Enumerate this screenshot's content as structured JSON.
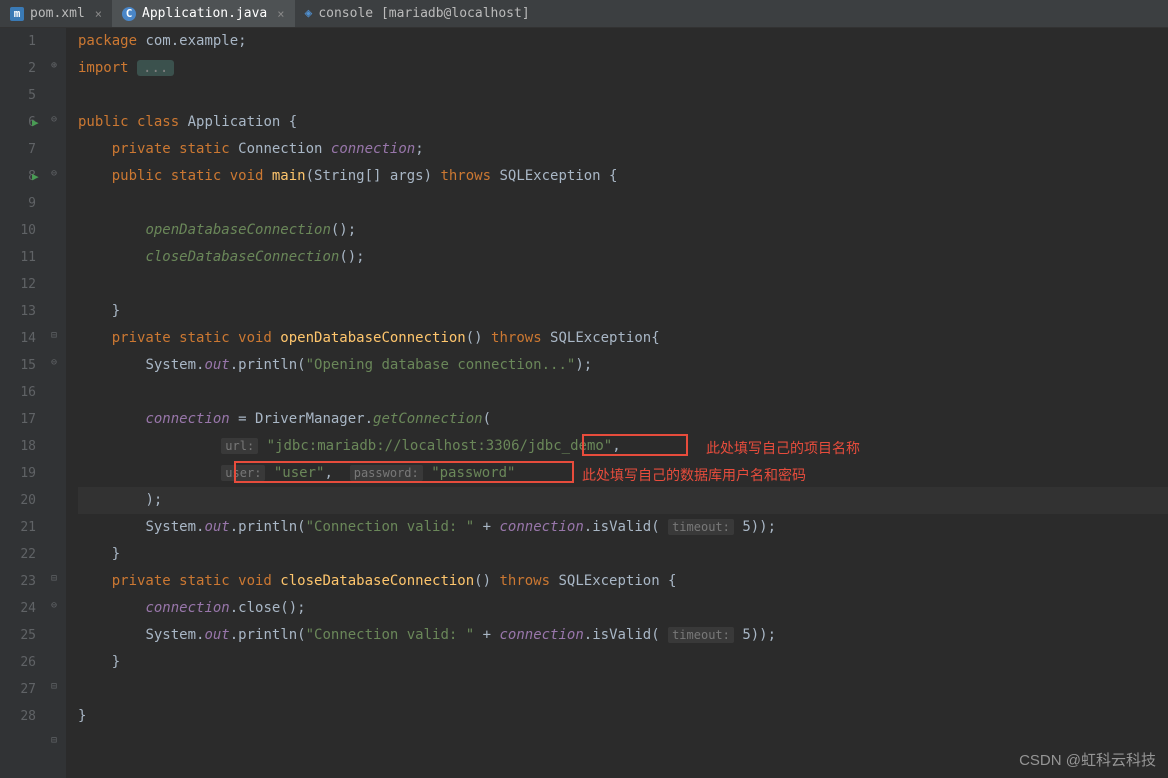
{
  "tabs": [
    {
      "label": "pom.xml",
      "icon": "m",
      "active": false
    },
    {
      "label": "Application.java",
      "icon": "c",
      "active": true
    },
    {
      "label": "console [mariadb@localhost]",
      "icon": "db",
      "active": false
    }
  ],
  "gutter": {
    "lines": [
      "1",
      "2",
      "5",
      "6",
      "7",
      "8",
      "9",
      "10",
      "11",
      "12",
      "13",
      "14",
      "15",
      "16",
      "17",
      "18",
      "19",
      "20",
      "21",
      "22",
      "23",
      "24",
      "25",
      "26",
      "27",
      "28"
    ],
    "runMarkers": [
      6,
      8
    ]
  },
  "code": {
    "l1": {
      "kw1": "package",
      "pkg": " com.example;"
    },
    "l2": {
      "kw1": "import",
      "folded": "..."
    },
    "l6": {
      "kw1": "public class",
      "cls": " Application {"
    },
    "l7": {
      "kw1": "private static",
      "type": " Connection ",
      "field": "connection",
      "t": ";"
    },
    "l8": {
      "kw1": "public static void",
      "method": " main",
      "sig": "(String[] args) ",
      "kw2": "throws",
      "ex": " SQLException {"
    },
    "l10": {
      "call": "openDatabaseConnection",
      "t": "();"
    },
    "l11": {
      "call": "closeDatabaseConnection",
      "t": "();"
    },
    "l13": {
      "t": "}"
    },
    "l14": {
      "kw1": "private static void",
      "method": " openDatabaseConnection",
      "sig": "() ",
      "kw2": "throws",
      "ex": " SQLException{"
    },
    "l15": {
      "obj": "System.",
      "f": "out",
      "m": ".println(",
      "s": "\"Opening database connection...\"",
      "t": ");"
    },
    "l17": {
      "f": "connection",
      "t1": " = DriverManager.",
      "m": "getConnection",
      "t2": "("
    },
    "l18": {
      "hint": "url:",
      "s1": "\"jdbc:mariadb://localhost:3306/",
      "s2": "jdbc_demo\"",
      "t": ","
    },
    "l19": {
      "hint1": "user:",
      "s1": "\"user\"",
      "t1": ",  ",
      "hint2": "password:",
      "s2": "\"password\""
    },
    "l20": {
      "t": ");"
    },
    "l21": {
      "obj": "System.",
      "f": "out",
      "m": ".println(",
      "s": "\"Connection valid: \"",
      "t1": " + ",
      "f2": "connection",
      "t2": ".isValid( ",
      "hint": "timeout:",
      "num": "5",
      "t3": "));"
    },
    "l22": {
      "t": "}"
    },
    "l23": {
      "kw1": "private static void",
      "method": " closeDatabaseConnection",
      "sig": "() ",
      "kw2": "throws",
      "ex": " SQLException {"
    },
    "l24": {
      "f": "connection",
      "t": ".close();"
    },
    "l25": {
      "obj": "System.",
      "f": "out",
      "m": ".println(",
      "s": "\"Connection valid: \"",
      "t1": " + ",
      "f2": "connection",
      "t2": ".isValid( ",
      "hint": "timeout:",
      "num": "5",
      "t3": "));"
    },
    "l26": {
      "t": "}"
    },
    "l28": {
      "t": "}"
    }
  },
  "annotations": {
    "a1": "此处填写自己的项目名称",
    "a2": "此处填写自己的数据库用户名和密码"
  },
  "watermark": "CSDN @虹科云科技"
}
